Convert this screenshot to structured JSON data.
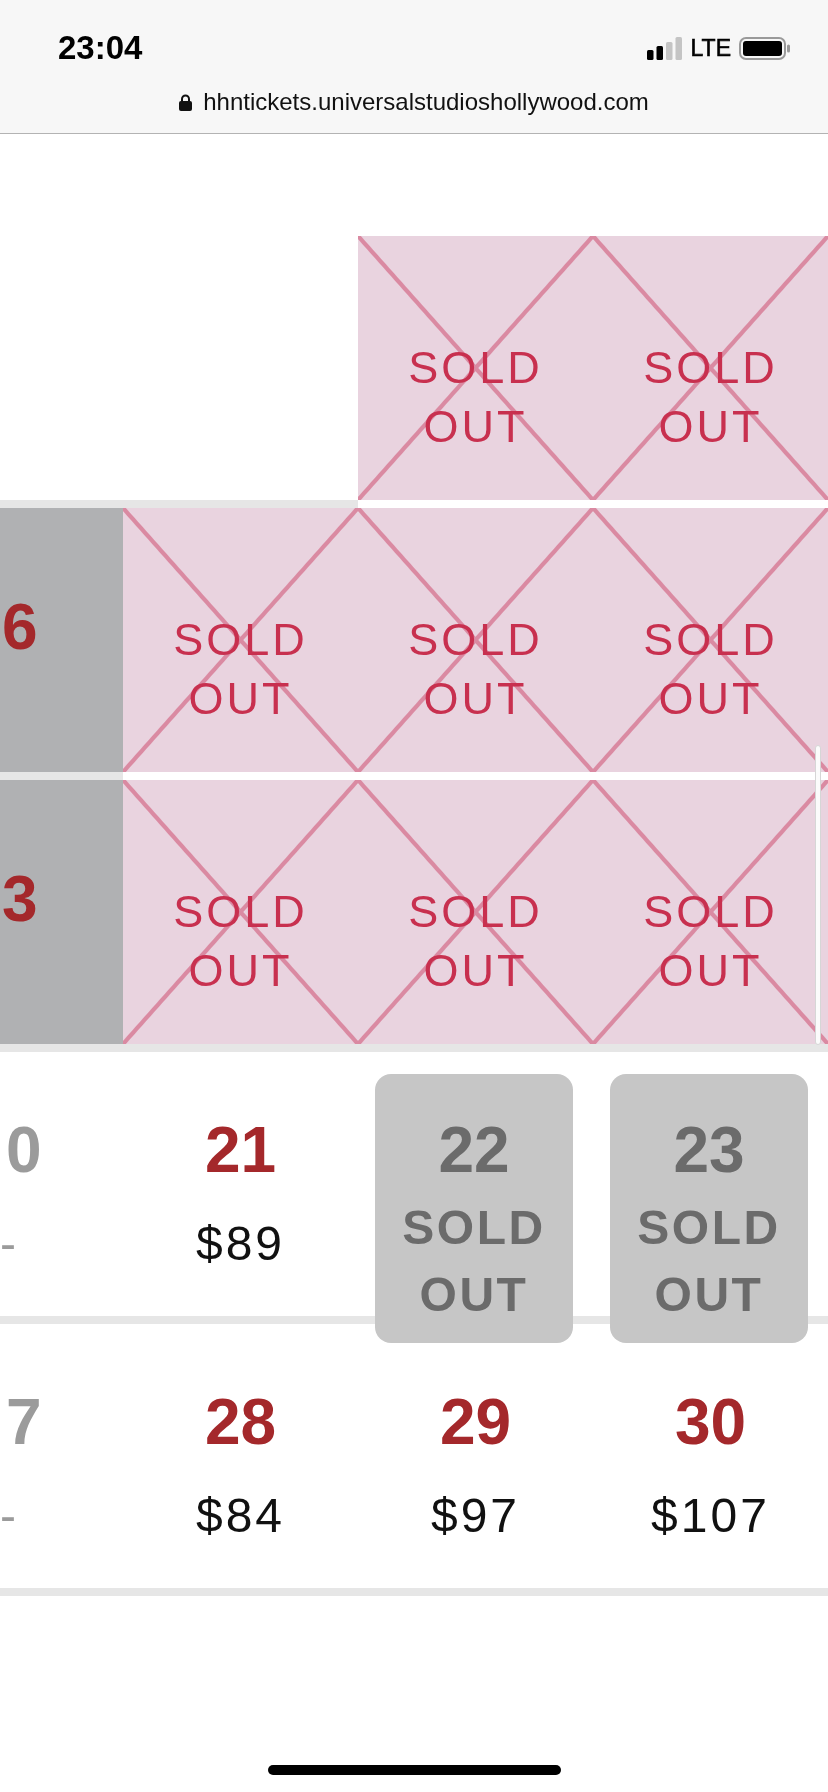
{
  "status_bar": {
    "time": "23:04",
    "network": "LTE"
  },
  "address_bar": {
    "url": "hhntickets.universalstudioshollywood.com"
  },
  "calendar": {
    "weeks": [
      {
        "days": [
          {
            "kind": "empty"
          },
          {
            "kind": "empty"
          },
          {
            "kind": "sold_out",
            "label": "SOLD OUT"
          },
          {
            "kind": "sold_out",
            "label": "SOLD OUT"
          }
        ]
      },
      {
        "days": [
          {
            "kind": "closed",
            "date": "6"
          },
          {
            "kind": "sold_out",
            "label": "SOLD OUT"
          },
          {
            "kind": "sold_out",
            "label": "SOLD OUT"
          },
          {
            "kind": "sold_out",
            "label": "SOLD OUT"
          }
        ]
      },
      {
        "days": [
          {
            "kind": "closed",
            "date": "3"
          },
          {
            "kind": "sold_out",
            "label": "SOLD OUT"
          },
          {
            "kind": "sold_out",
            "label": "SOLD OUT"
          },
          {
            "kind": "sold_out",
            "label": "SOLD OUT"
          }
        ]
      },
      {
        "days": [
          {
            "kind": "unavailable",
            "date": "0",
            "price": "-"
          },
          {
            "kind": "available",
            "date": "21",
            "price": "$89"
          },
          {
            "kind": "sold_out_tile",
            "date": "22",
            "label": "SOLD OUT"
          },
          {
            "kind": "sold_out_tile",
            "date": "23",
            "label": "SOLD OUT"
          }
        ]
      },
      {
        "days": [
          {
            "kind": "unavailable",
            "date": "7",
            "price": "-"
          },
          {
            "kind": "available",
            "date": "28",
            "price": "$84"
          },
          {
            "kind": "available",
            "date": "29",
            "price": "$97"
          },
          {
            "kind": "available",
            "date": "30",
            "price": "$107"
          }
        ]
      }
    ]
  }
}
